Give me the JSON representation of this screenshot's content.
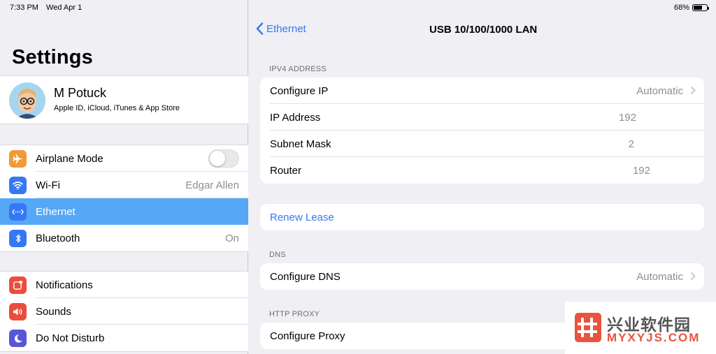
{
  "status": {
    "time": "7:33 PM",
    "date": "Wed Apr 1",
    "battery": "68%",
    "battery_level": 0.68
  },
  "sidebar": {
    "title": "Settings",
    "profile": {
      "name": "M Potuck",
      "subtitle": "Apple ID, iCloud, iTunes & App Store"
    },
    "group1": [
      {
        "label": "Airplane Mode",
        "icon": "airplane-icon",
        "color": "#f19a37",
        "value": "",
        "toggle": false
      },
      {
        "label": "Wi-Fi",
        "icon": "wifi-icon",
        "color": "#3478f6",
        "value": "Edgar Allen"
      },
      {
        "label": "Ethernet",
        "icon": "ethernet-icon",
        "color": "#3478f6",
        "value": "",
        "selected": true
      },
      {
        "label": "Bluetooth",
        "icon": "bluetooth-icon",
        "color": "#3478f6",
        "value": "On"
      }
    ],
    "group2": [
      {
        "label": "Notifications",
        "icon": "notifications-icon",
        "color": "#eb4d3d"
      },
      {
        "label": "Sounds",
        "icon": "sounds-icon",
        "color": "#eb4d3d"
      },
      {
        "label": "Do Not Disturb",
        "icon": "moon-icon",
        "color": "#5856d6"
      }
    ]
  },
  "detail": {
    "back_label": "Ethernet",
    "title": "USB 10/100/1000 LAN",
    "ipv4": {
      "header": "IPV4 ADDRESS",
      "rows": [
        {
          "label": "Configure IP",
          "value": "Automatic"
        },
        {
          "label": "IP Address",
          "value": "192"
        },
        {
          "label": "Subnet Mask",
          "value": "2"
        },
        {
          "label": "Router",
          "value": "192"
        }
      ]
    },
    "renew_lease": "Renew Lease",
    "dns": {
      "header": "DNS",
      "label": "Configure DNS",
      "value": "Automatic"
    },
    "proxy": {
      "header": "HTTP PROXY",
      "label": "Configure Proxy"
    }
  },
  "watermark": {
    "title": "兴业软件园",
    "subtitle": "MYXYJS.COM",
    "color": "#e8543e"
  }
}
